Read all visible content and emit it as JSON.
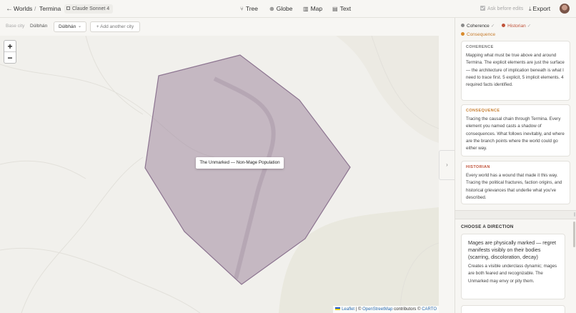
{
  "breadcrumb": {
    "root": "Worlds",
    "separator": "/",
    "current": "Termina"
  },
  "model_badge": "Claude Sonnet 4",
  "nav": [
    {
      "label": "Tree",
      "icon": "tree-icon"
    },
    {
      "label": "Globe",
      "icon": "globe-icon"
    },
    {
      "label": "Map",
      "icon": "map-icon"
    },
    {
      "label": "Text",
      "icon": "document-icon"
    }
  ],
  "ask_before_edits": {
    "label": "Ask before edits",
    "checked": true
  },
  "export_label": "Export",
  "city": {
    "base_label": "Base city",
    "base_value": "Dúlbhán",
    "selected": "Dúlbhán",
    "add_label": "+ Add another city"
  },
  "map": {
    "zoom_in": "+",
    "zoom_out": "−",
    "popup": "The Unmarked — Non-Mage Population",
    "polygon_fill": "#a08aa0",
    "attribution": {
      "leaflet": "Leaflet",
      "sep": " | © ",
      "osm": "OpenStreetMap",
      "contributors": " contributors © ",
      "carto": "CARTO"
    }
  },
  "panel": {
    "legend": [
      {
        "label": "Coherence",
        "color": "#8a8a8a",
        "done": true
      },
      {
        "label": "Historian",
        "color": "#c0533a",
        "done": true
      },
      {
        "label": "Consequence",
        "color": "#d98a2b",
        "done": false
      }
    ],
    "cards": [
      {
        "title": "COHERENCE",
        "color": "#777777",
        "body": "Mapping what must be true above and around Termina. The explicit elements are just the surface — the architecture of implication beneath is what I need to trace first. 5 explicit, 5 implicit elements. 4 required facts identified."
      },
      {
        "title": "CONSEQUENCE",
        "color": "#c77d2e",
        "body": "Tracing the causal chain through Termina. Every element you named casts a shadow of consequences. What follows inevitably, and where are the branch points where the world could go either way."
      },
      {
        "title": "HISTORIAN",
        "color": "#c0533a",
        "body": "Every world has a wound that made it this way. Tracing the political fractures, faction origins, and historical grievances that underlie what you've described."
      }
    ],
    "choose_title": "CHOOSE A DIRECTION",
    "option": {
      "title": "Mages are physically marked — regret manifests visibly on their bodies (scarring, discoloration, decay)",
      "body": "Creates a visible underclass dynamic; mages are both feared and recognizable. The Unmarked may envy or pity them."
    }
  }
}
